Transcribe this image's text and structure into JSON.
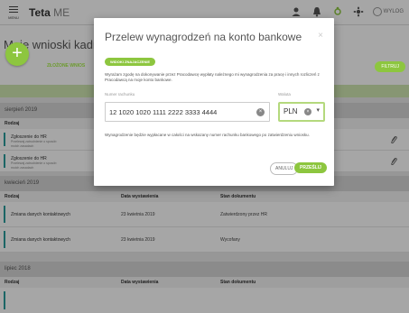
{
  "topbar": {
    "menu_label": "MENU",
    "brand": "Teta",
    "brand_suffix": "ME",
    "logout_label": "WYLOG"
  },
  "page": {
    "title": "Moje wnioski kadr",
    "tab_label": "ZŁOŻONE WNIOS",
    "filter_label": "FILTRUJ",
    "add_symbol": "+"
  },
  "columns": {
    "type": "Rodzaj",
    "date": "Data wystawienia",
    "status": "Stan dokumentu"
  },
  "sections": [
    {
      "label": "sierpień 2019",
      "rows": [
        {
          "title": "Zgłoszenie do HR",
          "desc1": "Przelewaj zatrudnienie o sposób",
          "desc2": "moich zasadach"
        },
        {
          "title": "Zgłoszenie do HR",
          "desc1": "Przelewaj zatrudnienie o sposób",
          "desc2": "moich zasadach"
        }
      ]
    },
    {
      "label": "kwiecień 2019",
      "rows": [
        {
          "title": "Zmiana danych kontaktowych",
          "date": "23 kwietnia 2019",
          "status": "Zatwierdzony przez HR"
        },
        {
          "title": "Zmiana danych kontaktowych",
          "date": "23 kwietnia 2019",
          "status": "Wycofany"
        }
      ]
    },
    {
      "label": "lipiec 2018"
    }
  ],
  "modal": {
    "title": "Przelew wynagrodzeń na konto bankowe",
    "close": "×",
    "tag": "WIDOKI ZNAJACZENIE",
    "consent": "Wyrażam zgodę na dokonywanie przez Pracodawcę wypłaty należnego mi wynagrodzenia za pracę i innych rozliczeń z Pracodawcą na moje konto bankowe.",
    "account_label": "Numer rachunku",
    "account_value": "12 1020 1020 1111 2222 3333 4444",
    "currency_label": "Waluta",
    "currency_value": "PLN",
    "note": "Wynagrodzenie będzie wypłacane w całości na wskazany numer rachunku bankowego po zatwierdzeniu wniosku.",
    "cancel_label": "ANULUJ",
    "send_label": "PRZEŚLIJ"
  },
  "colors": {
    "accent": "#8dc63f",
    "row_marker": "#2a9d9d"
  }
}
